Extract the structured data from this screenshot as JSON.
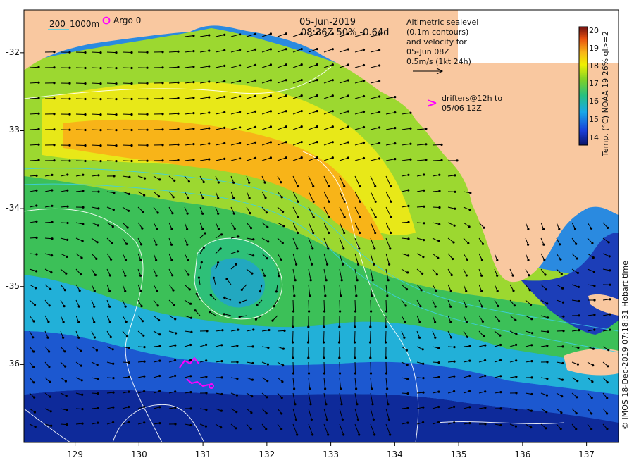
{
  "title": {
    "date": "05-Jun-2019",
    "line2": "08:36Z  50% -0.64d"
  },
  "scale_legend": {
    "depth_200": "200",
    "depth_1000": "1000m",
    "argo_label": "Argo 0"
  },
  "altimetry_note": [
    "Altimetric sealevel",
    "(0.1m contours)",
    "and velocity for",
    "05-Jun 08Z",
    "0.5m/s (1kt 24h)"
  ],
  "drifters_note": [
    "drifters@12h to",
    "05/06 12Z"
  ],
  "drifters_glyph": ">",
  "colorbar": {
    "label": "Temp. (°C) NOAA 19 26% ql>=2",
    "ticks": [
      "20",
      "19",
      "18",
      "17",
      "16",
      "15",
      "14"
    ],
    "min": 13.5,
    "max": 20.3
  },
  "credit": "© IMOS 18-Dec-2019 07:18:31 Hobart time",
  "axes": {
    "lat_ticks": [
      {
        "v": -32,
        "label": "-32"
      },
      {
        "v": -33,
        "label": "-33"
      },
      {
        "v": -34,
        "label": "-34"
      },
      {
        "v": -35,
        "label": "-35"
      },
      {
        "v": -36,
        "label": "-36"
      }
    ],
    "lon_ticks": [
      {
        "v": 129,
        "label": "129"
      },
      {
        "v": 130,
        "label": "130"
      },
      {
        "v": 131,
        "label": "131"
      },
      {
        "v": 132,
        "label": "132"
      },
      {
        "v": 133,
        "label": "133"
      },
      {
        "v": 134,
        "label": "134"
      },
      {
        "v": 135,
        "label": "135"
      },
      {
        "v": 136,
        "label": "136"
      },
      {
        "v": 137,
        "label": "137"
      }
    ]
  },
  "colors": {
    "land": "#f9c8a0",
    "drifter": "#ff00ff",
    "contour": "#ffffff",
    "isobath": "#3cd0e8",
    "arrow": "#000000"
  }
}
